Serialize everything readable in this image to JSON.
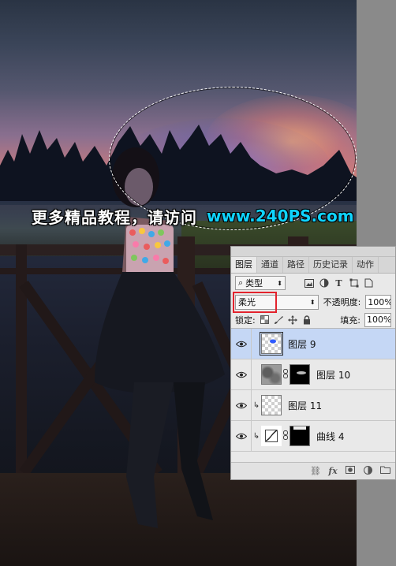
{
  "watermark": {
    "text_cn": "更多精品教程，请访问",
    "url": "www.240PS.com"
  },
  "layers_panel": {
    "tabs": [
      {
        "label": "图层",
        "active": true
      },
      {
        "label": "通道",
        "active": false
      },
      {
        "label": "路径",
        "active": false
      },
      {
        "label": "历史记录",
        "active": false
      },
      {
        "label": "动作",
        "active": false
      }
    ],
    "filter": {
      "search_glyph": "⌕",
      "value": "类型"
    },
    "filter_icons": [
      "image-filter-icon",
      "adjustment-filter-icon",
      "type-filter-icon",
      "shape-filter-icon",
      "smartobject-filter-icon"
    ],
    "blend_mode": "柔光",
    "opacity_label": "不透明度:",
    "opacity_value": "100%",
    "lock_label": "锁定:",
    "fill_label": "填充:",
    "fill_value": "100%",
    "layers": [
      {
        "name": "图层 9",
        "selected": true,
        "clipped": false,
        "thumb": "transparent-blue"
      },
      {
        "name": "图层 10",
        "selected": false,
        "clipped": false,
        "thumb": "gray-mask"
      },
      {
        "name": "图层 11",
        "selected": false,
        "clipped": true,
        "thumb": "transparent"
      },
      {
        "name": "曲线 4",
        "selected": false,
        "clipped": true,
        "thumb": "curves-mask"
      }
    ],
    "bottom_icons": [
      "link-icon",
      "fx-icon",
      "mask-icon",
      "adjustment-icon",
      "folder-icon"
    ],
    "colors": {
      "selected_row": "#c5d7f5",
      "highlight_box": "#e3232d",
      "watermark_url": "#0fd3ff"
    }
  }
}
